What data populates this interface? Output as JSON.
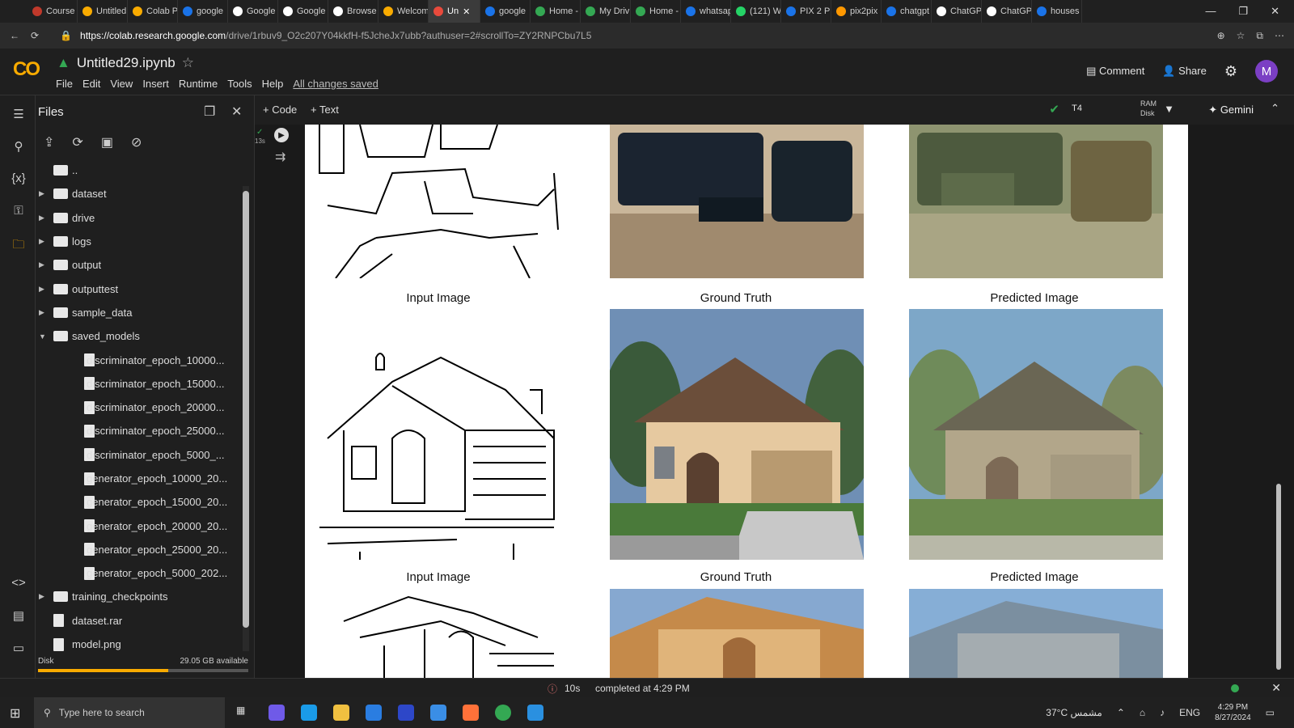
{
  "browser": {
    "tabs": [
      {
        "label": "Course",
        "color": "#c0392b"
      },
      {
        "label": "Untitled",
        "color": "#f9ab00"
      },
      {
        "label": "Colab P",
        "color": "#f9ab00"
      },
      {
        "label": "google",
        "color": "#1a73e8"
      },
      {
        "label": "Google",
        "color": "#ffffff"
      },
      {
        "label": "Google",
        "color": "#ffffff"
      },
      {
        "label": "Browse",
        "color": "#ffffff"
      },
      {
        "label": "Welcom",
        "color": "#f9ab00"
      },
      {
        "label": "Un",
        "color": "#e84a3c",
        "active": true
      },
      {
        "label": "google",
        "color": "#1a73e8"
      },
      {
        "label": "Home -",
        "color": "#34a853"
      },
      {
        "label": "My Driv",
        "color": "#34a853"
      },
      {
        "label": "Home -",
        "color": "#34a853"
      },
      {
        "label": "whatsap",
        "color": "#1a73e8"
      },
      {
        "label": "(121) W",
        "color": "#25d366"
      },
      {
        "label": "PIX 2 PI",
        "color": "#1a73e8"
      },
      {
        "label": "pix2pix",
        "color": "#ff9800"
      },
      {
        "label": "chatgpt",
        "color": "#1a73e8"
      },
      {
        "label": "ChatGP",
        "color": "#ffffff"
      },
      {
        "label": "ChatGP",
        "color": "#ffffff"
      },
      {
        "label": "houses",
        "color": "#1a73e8"
      }
    ],
    "url_host": "https://colab.research.google.com",
    "url_path": "/drive/1rbuv9_O2c207Y04kkfH-f5JcheJx7ubb?authuser=2#scrollTo=ZY2RNPCbu7L5"
  },
  "colab": {
    "logo": "CO",
    "notebook_title": "Untitled29.ipynb",
    "menu": [
      "File",
      "Edit",
      "View",
      "Insert",
      "Runtime",
      "Tools",
      "Help"
    ],
    "saved_status": "All changes saved",
    "comment_label": "Comment",
    "share_label": "Share",
    "avatar_initial": "M",
    "add_code_label": "+ Code",
    "add_text_label": "+ Text",
    "runtime_type": "T4",
    "ram_label": "RAM",
    "disk_label": "Disk",
    "gemini_label": "Gemini",
    "exec_time": "13s"
  },
  "files_panel": {
    "title": "Files",
    "items": [
      {
        "name": "..",
        "type": "folder",
        "level": 0,
        "arrow": ""
      },
      {
        "name": "dataset",
        "type": "folder",
        "level": 0,
        "arrow": "▶"
      },
      {
        "name": "drive",
        "type": "folder",
        "level": 0,
        "arrow": "▶"
      },
      {
        "name": "logs",
        "type": "folder",
        "level": 0,
        "arrow": "▶"
      },
      {
        "name": "output",
        "type": "folder",
        "level": 0,
        "arrow": "▶"
      },
      {
        "name": "outputtest",
        "type": "folder",
        "level": 0,
        "arrow": "▶"
      },
      {
        "name": "sample_data",
        "type": "folder",
        "level": 0,
        "arrow": "▶"
      },
      {
        "name": "saved_models",
        "type": "folder",
        "level": 0,
        "arrow": "▼"
      },
      {
        "name": "discriminator_epoch_10000...",
        "type": "file",
        "level": 1,
        "arrow": ""
      },
      {
        "name": "discriminator_epoch_15000...",
        "type": "file",
        "level": 1,
        "arrow": ""
      },
      {
        "name": "discriminator_epoch_20000...",
        "type": "file",
        "level": 1,
        "arrow": ""
      },
      {
        "name": "discriminator_epoch_25000...",
        "type": "file",
        "level": 1,
        "arrow": ""
      },
      {
        "name": "discriminator_epoch_5000_...",
        "type": "file",
        "level": 1,
        "arrow": ""
      },
      {
        "name": "generator_epoch_10000_20...",
        "type": "file",
        "level": 1,
        "arrow": ""
      },
      {
        "name": "generator_epoch_15000_20...",
        "type": "file",
        "level": 1,
        "arrow": ""
      },
      {
        "name": "generator_epoch_20000_20...",
        "type": "file",
        "level": 1,
        "arrow": ""
      },
      {
        "name": "generator_epoch_25000_20...",
        "type": "file",
        "level": 1,
        "arrow": ""
      },
      {
        "name": "generator_epoch_5000_202...",
        "type": "file",
        "level": 1,
        "arrow": ""
      },
      {
        "name": "training_checkpoints",
        "type": "folder",
        "level": 0,
        "arrow": "▶"
      },
      {
        "name": "dataset.rar",
        "type": "file",
        "level": 0,
        "arrow": ""
      },
      {
        "name": "model.png",
        "type": "file",
        "level": 0,
        "arrow": ""
      }
    ],
    "disk_label": "Disk",
    "disk_available": "29.05 GB available",
    "disk_used_fraction": 0.62
  },
  "output": {
    "captions": [
      "Input Image",
      "Ground Truth",
      "Predicted Image"
    ]
  },
  "status_bar": {
    "duration": "10s",
    "message": "completed at 4:29 PM"
  },
  "taskbar": {
    "search_placeholder": "Type here to search",
    "weather": "37°C  مشمس",
    "language": "ENG",
    "time": "4:29 PM",
    "date": "8/27/2024"
  }
}
